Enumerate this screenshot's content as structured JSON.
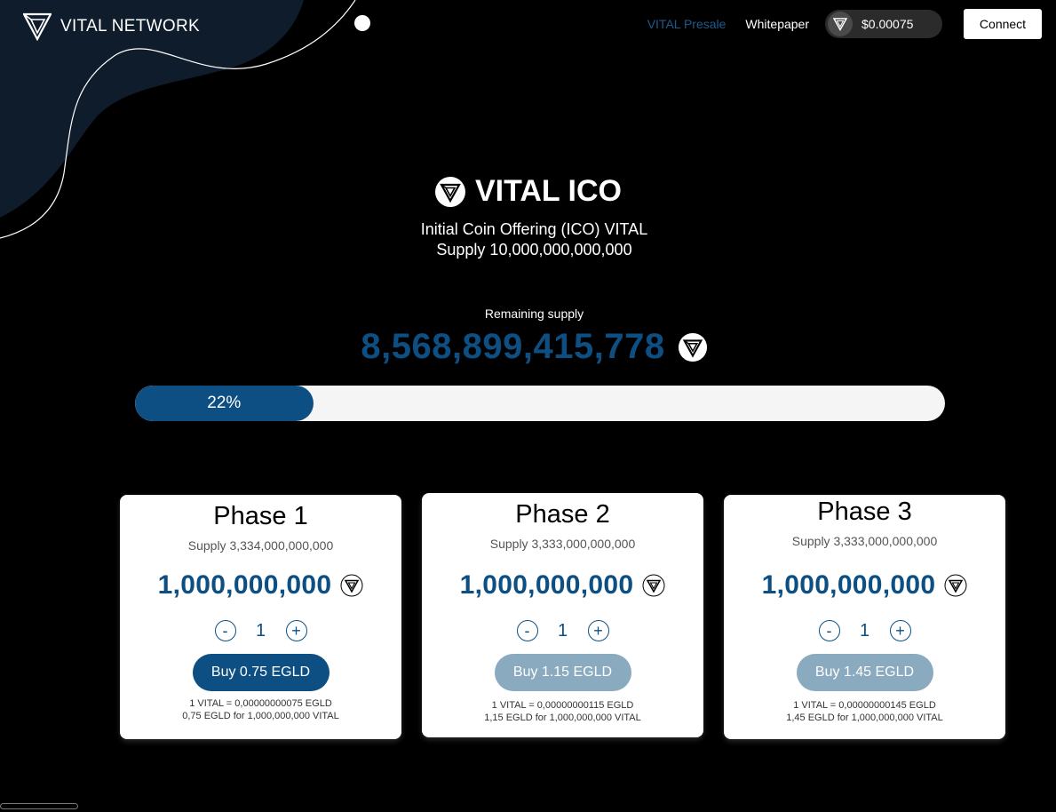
{
  "header": {
    "brand": "VITAL NETWORK",
    "nav": {
      "presale": "VITAL Presale",
      "whitepaper": "Whitepaper"
    },
    "price": "$0.00075",
    "connect_label": "Connect"
  },
  "hero": {
    "title": "VITAL ICO",
    "subtitle_line1": "Initial Coin Offering (ICO) VITAL",
    "subtitle_line2": "Supply 10,000,000,000,000",
    "remaining_label": "Remaining supply",
    "remaining_value": "8,568,899,415,778"
  },
  "progress": {
    "label": "22%",
    "percent": 22
  },
  "phases": [
    {
      "title": "Phase 1",
      "supply": "Supply 3,334,000,000,000",
      "amount": "1,000,000,000",
      "minus": "-",
      "quantity": "1",
      "plus": "+",
      "buy_label": "Buy 0.75 EGLD",
      "note_line1": "1 VITAL = 0,00000000075 EGLD",
      "note_line2": "0,75 EGLD for 1,000,000,000 VITAL"
    },
    {
      "title": "Phase 2",
      "supply": "Supply 3,333,000,000,000",
      "amount": "1,000,000,000",
      "minus": "-",
      "quantity": "1",
      "plus": "+",
      "buy_label": "Buy 1.15 EGLD",
      "note_line1": "1 VITAL = 0,00000000115 EGLD",
      "note_line2": "1,15 EGLD for 1,000,000,000 VITAL"
    },
    {
      "title": "Phase 3",
      "supply": "Supply 3,333,000,000,000",
      "amount": "1,000,000,000",
      "minus": "-",
      "quantity": "1",
      "plus": "+",
      "buy_label": "Buy 1.45 EGLD",
      "note_line1": "1 VITAL = 0,00000000145 EGLD",
      "note_line2": "1,45 EGLD for 1,000,000,000 VITAL"
    }
  ],
  "colors": {
    "accent": "#0d4f82",
    "accent_disabled": "#89aabf",
    "nav_active": "#1e5a8c",
    "background": "#000000",
    "blob": "#0f1c2c"
  }
}
